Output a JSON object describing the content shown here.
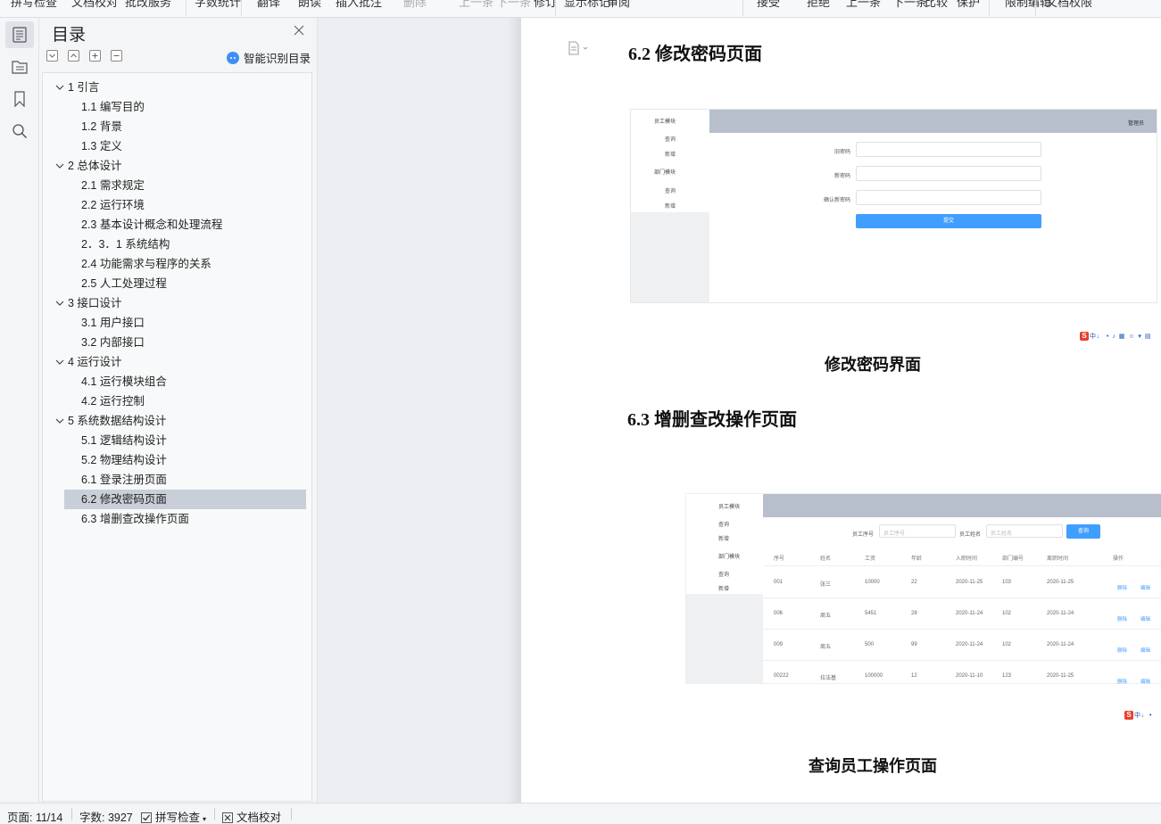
{
  "ribbon": {
    "items": [
      "拼写检查",
      "文档校对",
      "批改服务",
      "字数统计",
      "翻译",
      "朗读",
      "插入批注",
      "删除",
      "上一条",
      "下一条",
      "修订",
      "显示标记",
      "审阅",
      "接受",
      "拒绝",
      "上一条",
      "下一条",
      "比较",
      "保护",
      "限制编辑",
      "文档权限"
    ],
    "disabled": [
      "删除",
      "上一条",
      "下一条"
    ]
  },
  "toc": {
    "title": "目录",
    "smart_label": "智能识别目录",
    "items": [
      {
        "level": 1,
        "label": "1 引言"
      },
      {
        "level": 2,
        "label": "1.1 编写目的"
      },
      {
        "level": 2,
        "label": "1.2 背景"
      },
      {
        "level": 2,
        "label": "1.3 定义"
      },
      {
        "level": 1,
        "label": "2 总体设计"
      },
      {
        "level": 2,
        "label": "2.1 需求规定"
      },
      {
        "level": 2,
        "label": "2.2 运行环境"
      },
      {
        "level": 2,
        "label": "2.3 基本设计概念和处理流程"
      },
      {
        "level": 2,
        "label": "2．3．1 系统结构"
      },
      {
        "level": 2,
        "label": "2.4 功能需求与程序的关系"
      },
      {
        "level": 2,
        "label": "2.5 人工处理过程"
      },
      {
        "level": 1,
        "label": "3 接口设计"
      },
      {
        "level": 2,
        "label": "3.1 用户接口"
      },
      {
        "level": 2,
        "label": "3.2 内部接口"
      },
      {
        "level": 1,
        "label": "4 运行设计"
      },
      {
        "level": 2,
        "label": "4.1 运行模块组合"
      },
      {
        "level": 2,
        "label": "4.2 运行控制"
      },
      {
        "level": 1,
        "label": "5 系统数据结构设计"
      },
      {
        "level": 2,
        "label": "5.1 逻辑结构设计"
      },
      {
        "level": 2,
        "label": "5.2  物理结构设计"
      },
      {
        "level": 2,
        "label": "6.1 登录注册页面"
      },
      {
        "level": 2,
        "label": "6.2 修改密码页面",
        "selected": true
      },
      {
        "level": 2,
        "label": "6.3 增删查改操作页面"
      }
    ]
  },
  "doc": {
    "heading_62": "6.2 修改密码页面",
    "caption_62": "修改密码界面",
    "heading_63": "6.3 增删查改操作页面",
    "caption_63": "查询员工操作页面",
    "shot1": {
      "menu1": "员工模块",
      "menu1_items": [
        "查询",
        "新增"
      ],
      "menu2": "部门模块",
      "menu2_items": [
        "查询",
        "新增"
      ],
      "user": "管理员",
      "fields": [
        "旧密码",
        "新密码",
        "确认新密码"
      ],
      "submit": "提交"
    },
    "shot2": {
      "menu1": "员工模块",
      "menu1_items": [
        "查询",
        "新增"
      ],
      "menu2": "部门模块",
      "menu2_items": [
        "查询",
        "新增"
      ],
      "search_label1": "员工序号",
      "search_ph1": "员工序号",
      "search_label2": "员工姓名",
      "search_ph2": "员工姓名",
      "search_btn": "查询",
      "headers": [
        "序号",
        "姓名",
        "工资",
        "年龄",
        "入职时间",
        "部门编号",
        "离职时间",
        "操作"
      ],
      "rows": [
        [
          "001",
          "张三",
          "10000",
          "22",
          "2020-11-25",
          "103",
          "2020-11-25"
        ],
        [
          "006",
          "周五",
          "5451",
          "28",
          "2020-11-24",
          "102",
          "2020-11-24"
        ],
        [
          "009",
          "周五",
          "500",
          "99",
          "2020-11-24",
          "102",
          "2020-11-24"
        ],
        [
          "00222",
          "拉法基",
          "100000",
          "12",
          "2020-11-10",
          "123",
          "2020-11-25"
        ]
      ],
      "delete": "删除",
      "edit": "编辑"
    },
    "ime_text": "中"
  },
  "status": {
    "page": "页面: 11/14",
    "words": "字数: 3927",
    "spell": "拼写检查",
    "proof": "文档校对"
  }
}
